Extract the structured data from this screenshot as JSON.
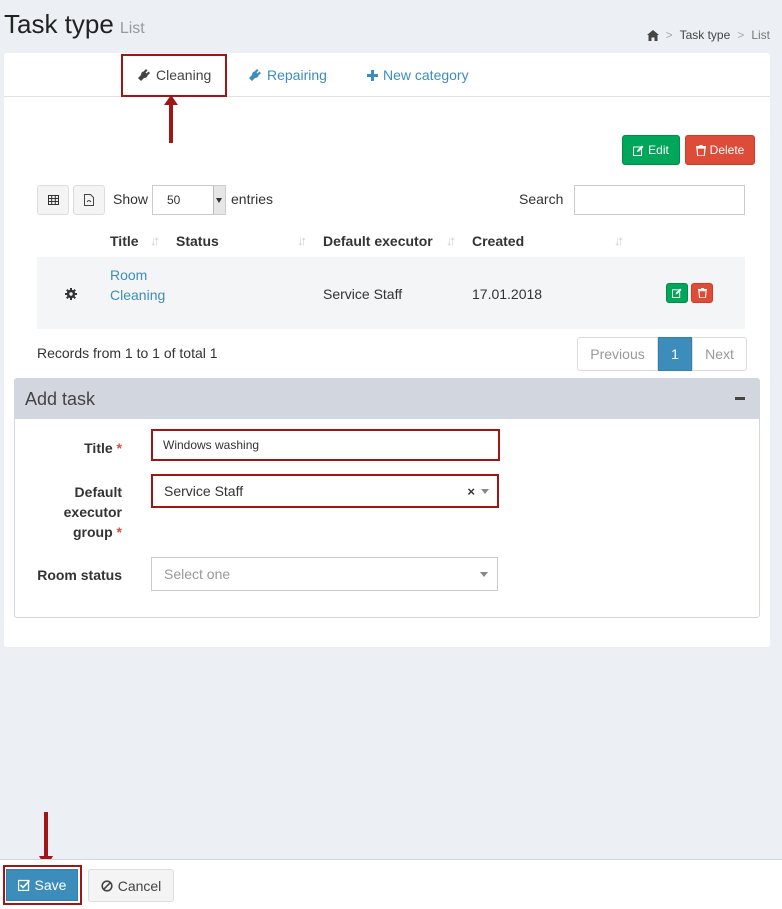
{
  "header": {
    "title": "Task type",
    "subtitle": "List",
    "breadcrumb": {
      "sep": ">",
      "items": [
        "Task type",
        "List"
      ]
    }
  },
  "tabs": [
    {
      "label": "Cleaning",
      "icon": "plug-icon",
      "active": true
    },
    {
      "label": "Repairing",
      "icon": "plug-icon",
      "active": false
    },
    {
      "label": "New category",
      "icon": "plus-icon",
      "active": false
    }
  ],
  "actions": {
    "edit_label": "Edit",
    "delete_label": "Delete"
  },
  "table_controls": {
    "show_label": "Show",
    "entries_value": "50",
    "entries_label": "entries",
    "search_label": "Search",
    "search_value": ""
  },
  "table": {
    "columns": [
      "Title",
      "Status",
      "Default executor",
      "Created"
    ],
    "rows": [
      {
        "title_line1": "Room",
        "title_line2": "Cleaning",
        "status": "",
        "executor": "Service Staff",
        "created": "17.01.2018"
      }
    ]
  },
  "records_text": "Records from 1 to 1 of total 1",
  "pagination": {
    "previous": "Previous",
    "current": "1",
    "next": "Next"
  },
  "add_task": {
    "title": "Add task",
    "fields": {
      "title_label": "Title",
      "title_value": "Windows washing",
      "executor_label_1": "Default",
      "executor_label_2": "executor",
      "executor_label_3": "group",
      "executor_value": "Service Staff",
      "clear_symbol": "×",
      "room_status_label": "Room status",
      "room_status_placeholder": "Select one",
      "required_mark": "*"
    }
  },
  "footer": {
    "save_label": "Save",
    "cancel_label": "Cancel"
  },
  "colors": {
    "accent": "#3c8dbc",
    "success": "#00a65a",
    "danger": "#dd4b39",
    "annotation": "#a01616"
  }
}
